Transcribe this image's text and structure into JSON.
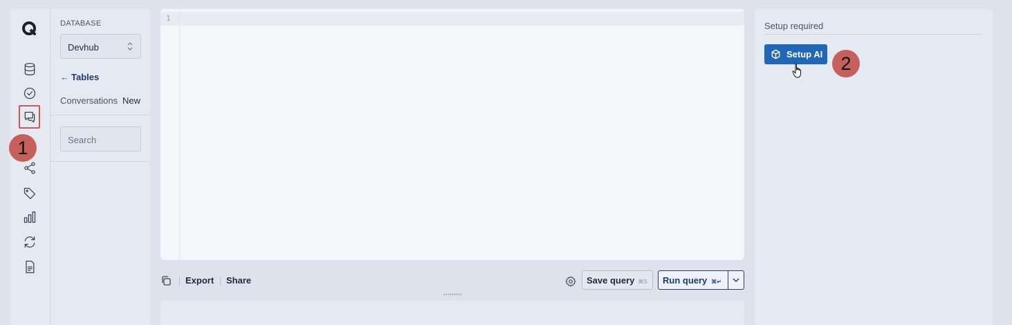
{
  "rail": {
    "icons": [
      "logo-icon",
      "database-icon",
      "check-circle-icon",
      "chat-icon",
      "share-icon",
      "tag-icon",
      "bar-chart-icon",
      "sync-icon",
      "document-icon"
    ]
  },
  "database": {
    "label": "DATABASE",
    "selected": "Devhub",
    "tables_link": "Tables",
    "tables_arrow": "←",
    "conversations_label": "Conversations",
    "new_label": "New",
    "search_placeholder": "Search"
  },
  "editor": {
    "line_number": "1"
  },
  "toolbar": {
    "export_label": "Export",
    "share_label": "Share",
    "save_label": "Save query",
    "save_shortcut": "⌘S",
    "run_label": "Run query",
    "run_shortcut": "⌘↵"
  },
  "ai_panel": {
    "title": "Setup required",
    "setup_button": "Setup AI"
  },
  "annotations": {
    "marker_1": "1",
    "marker_2": "2"
  },
  "colors": {
    "background": "#dde2ed",
    "panel": "#e5e9f2",
    "accent": "#2167b8",
    "marker": "#c5605c",
    "highlight_box": "#c75a55"
  }
}
